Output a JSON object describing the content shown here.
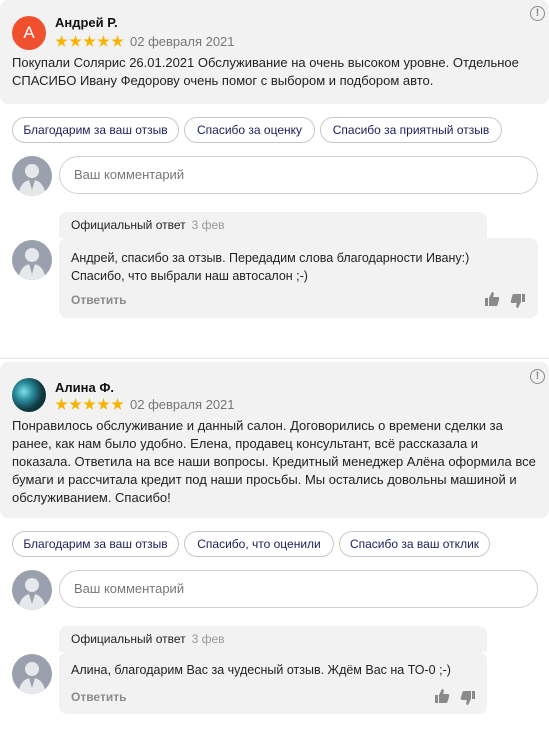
{
  "reviews": [
    {
      "author": "Андрей Р.",
      "avatar_letter": "А",
      "rating": 5,
      "date": "02 февраля 2021",
      "text": "Покупали Солярис 26.01.2021 Обслуживание на очень высоком уровне. Отдельное СПАСИБО Ивану Федорову очень помог с выбором и подбором авто.",
      "info_icon": "!",
      "quick_replies": [
        "Благодарим за ваш отзыв",
        "Спасибо за оценку",
        "Спасибо за приятный отзыв"
      ],
      "comment_placeholder": "Ваш комментарий",
      "official_reply": {
        "label": "Официальный ответ",
        "ago": "3 фев",
        "text": "Андрей, спасибо за отзыв. Передадим слова благодарности Ивану:) Спасибо, что выбрали наш автосалон ;-)",
        "reply_button": "Ответить"
      }
    },
    {
      "author": "Алина Ф.",
      "rating": 5,
      "date": "02 февраля 2021",
      "text": "Понравилось обслуживание и данный салон. Договорились о времени сделки за ранее, как нам было удобно. Елена, продавец консультант, всё рассказала и показала. Ответила на все наши вопросы. Кредитный менеджер Алёна оформила все бумаги и рассчитала кредит под наши просьбы. Мы остались довольны машиной и обслуживанием. Спасибо!",
      "info_icon": "!",
      "quick_replies": [
        "Благодарим за ваш отзыв",
        "Спасибо, что оценили",
        "Спасибо за ваш отклик"
      ],
      "comment_placeholder": "Ваш комментарий",
      "official_reply": {
        "label": "Официальный ответ",
        "ago": "3 фев",
        "text": "Алина, благодарим Вас за чудесный отзыв. Ждём Вас на ТО-0 ;-)",
        "reply_button": "Ответить"
      }
    }
  ],
  "colors": {
    "star": "#f7b300",
    "avatar_letter_bg": "#f0502e",
    "chip_text": "#1b1f5a",
    "card_bg": "#f2f2f2"
  }
}
